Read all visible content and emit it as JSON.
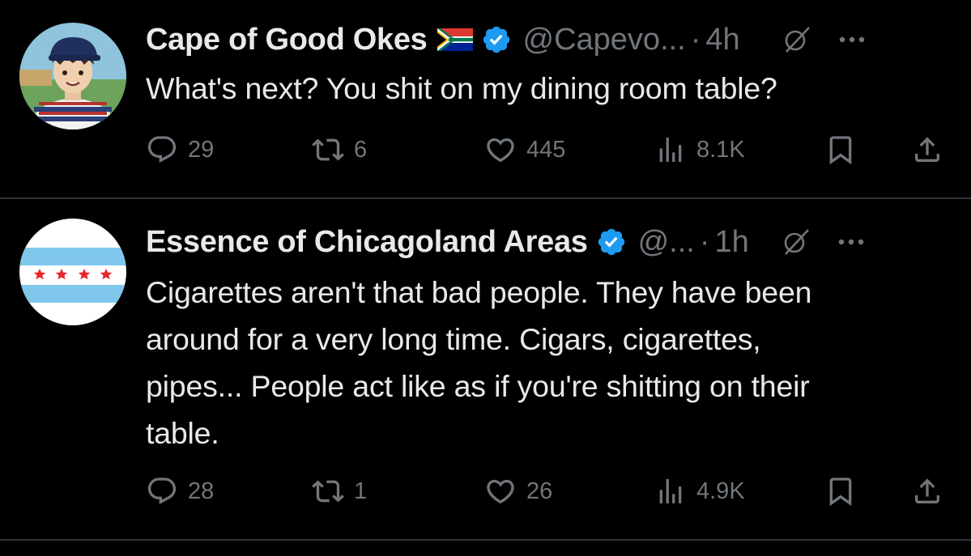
{
  "tweets": [
    {
      "name": "Cape of Good Okes",
      "handle": "@Capevo...",
      "separator": "·",
      "time": "4h",
      "text_lines": [
        "What's next? You shit on my dining room table?"
      ],
      "replies": "29",
      "reposts": "6",
      "likes": "445",
      "views": "8.1K",
      "flag_icon": "south-africa-flag",
      "verified_color": "#1d9bf0"
    },
    {
      "name": "Essence of Chicagoland Areas",
      "handle": "@...",
      "separator": "·",
      "time": "1h",
      "text_lines": [
        "Cigarettes aren't that bad people. They have been",
        "around for a very long time. Cigars, cigarettes,",
        "pipes... People act like as if you're shitting on their",
        "table."
      ],
      "replies": "28",
      "reposts": "1",
      "likes": "26",
      "views": "4.9K",
      "verified_color": "#1d9bf0"
    }
  ],
  "colors": {
    "background": "#000000",
    "text": "#e7e9ea",
    "muted": "#71767b",
    "divider": "#2f3336",
    "verified": "#1d9bf0"
  }
}
